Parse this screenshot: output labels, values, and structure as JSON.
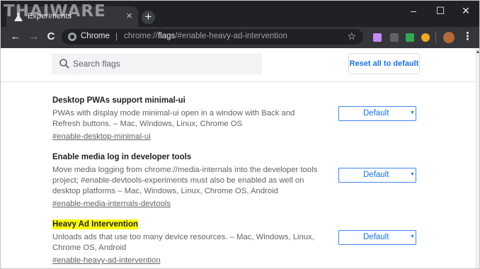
{
  "window": {
    "watermark": "THAIWARE",
    "controls": {
      "minimize": "–",
      "maximize": "☐",
      "close": "✕"
    }
  },
  "tab": {
    "title": "Experiments",
    "close": "×",
    "new_tab": "+"
  },
  "toolbar": {
    "back": "←",
    "forward": "→",
    "reload": "C",
    "site_label": "Chrome",
    "separator": "|",
    "url_prefix": "chrome://",
    "url_host": "flags",
    "url_rest": "/#enable-heavy-ad-intervention",
    "star": "☆",
    "menu": "⋮"
  },
  "search": {
    "placeholder": "Search flags",
    "value": ""
  },
  "reset_button": "Reset all to default",
  "flags": [
    {
      "title": "Desktop PWAs support minimal-ui",
      "description": "PWAs with display mode minimal-ui open in a window with Back and Refresh buttons. – Mac, Windows, Linux, Chrome OS",
      "link": "#enable-desktop-minimal-ui",
      "value": "Default",
      "highlighted": false
    },
    {
      "title": "Enable media log in developer tools",
      "description": "Move media logging from chrome://media-internals into the developer tools project; #enable-devtools-experiments must also be enabled as well on desktop platforms – Mac, Windows, Linux, Chrome OS, Android",
      "link": "#enable-media-internals-devtools",
      "value": "Default",
      "highlighted": false
    },
    {
      "title": "Heavy Ad Intervention",
      "description": "Unloads ads that use too many device resources. – Mac, Windows, Linux, Chrome OS, Android",
      "link": "#enable-heavy-ad-intervention",
      "value": "Default",
      "highlighted": true
    }
  ],
  "colors": {
    "accent": "#1a73e8",
    "highlight": "#ffff00",
    "titlebar": "#202124",
    "toolbar": "#35363a"
  }
}
